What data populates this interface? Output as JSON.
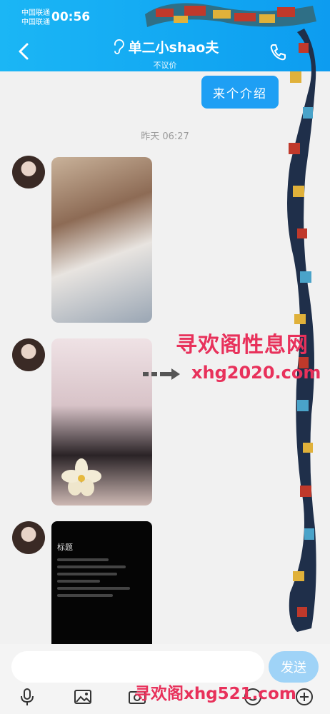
{
  "status_bar": {
    "carrier_1": "中国联通",
    "carrier_2": "中国联通",
    "time": "00:56"
  },
  "header": {
    "title": "单二小shao夫",
    "subtitle": "不议价",
    "icons": [
      "back-arrow",
      "ear",
      "phone"
    ]
  },
  "messages": {
    "outgoing_text": "来个介绍",
    "timestamp": "昨天 06:27",
    "phone_screenshot_title": "标题"
  },
  "watermark": {
    "site_name": "寻欢阁性息网",
    "site_url": "xhg2020.com",
    "bottom_text": "寻欢阁xhg521.com"
  },
  "input_bar": {
    "input_value": "",
    "send_label": "发送",
    "icons": [
      "mic",
      "image",
      "camera",
      "emoji",
      "plus"
    ]
  },
  "colors": {
    "header_blue": "#12a7f2",
    "bubble_blue": "#1e9ff4",
    "send_button": "#9fd3f7",
    "watermark_red": "#e8315b"
  }
}
